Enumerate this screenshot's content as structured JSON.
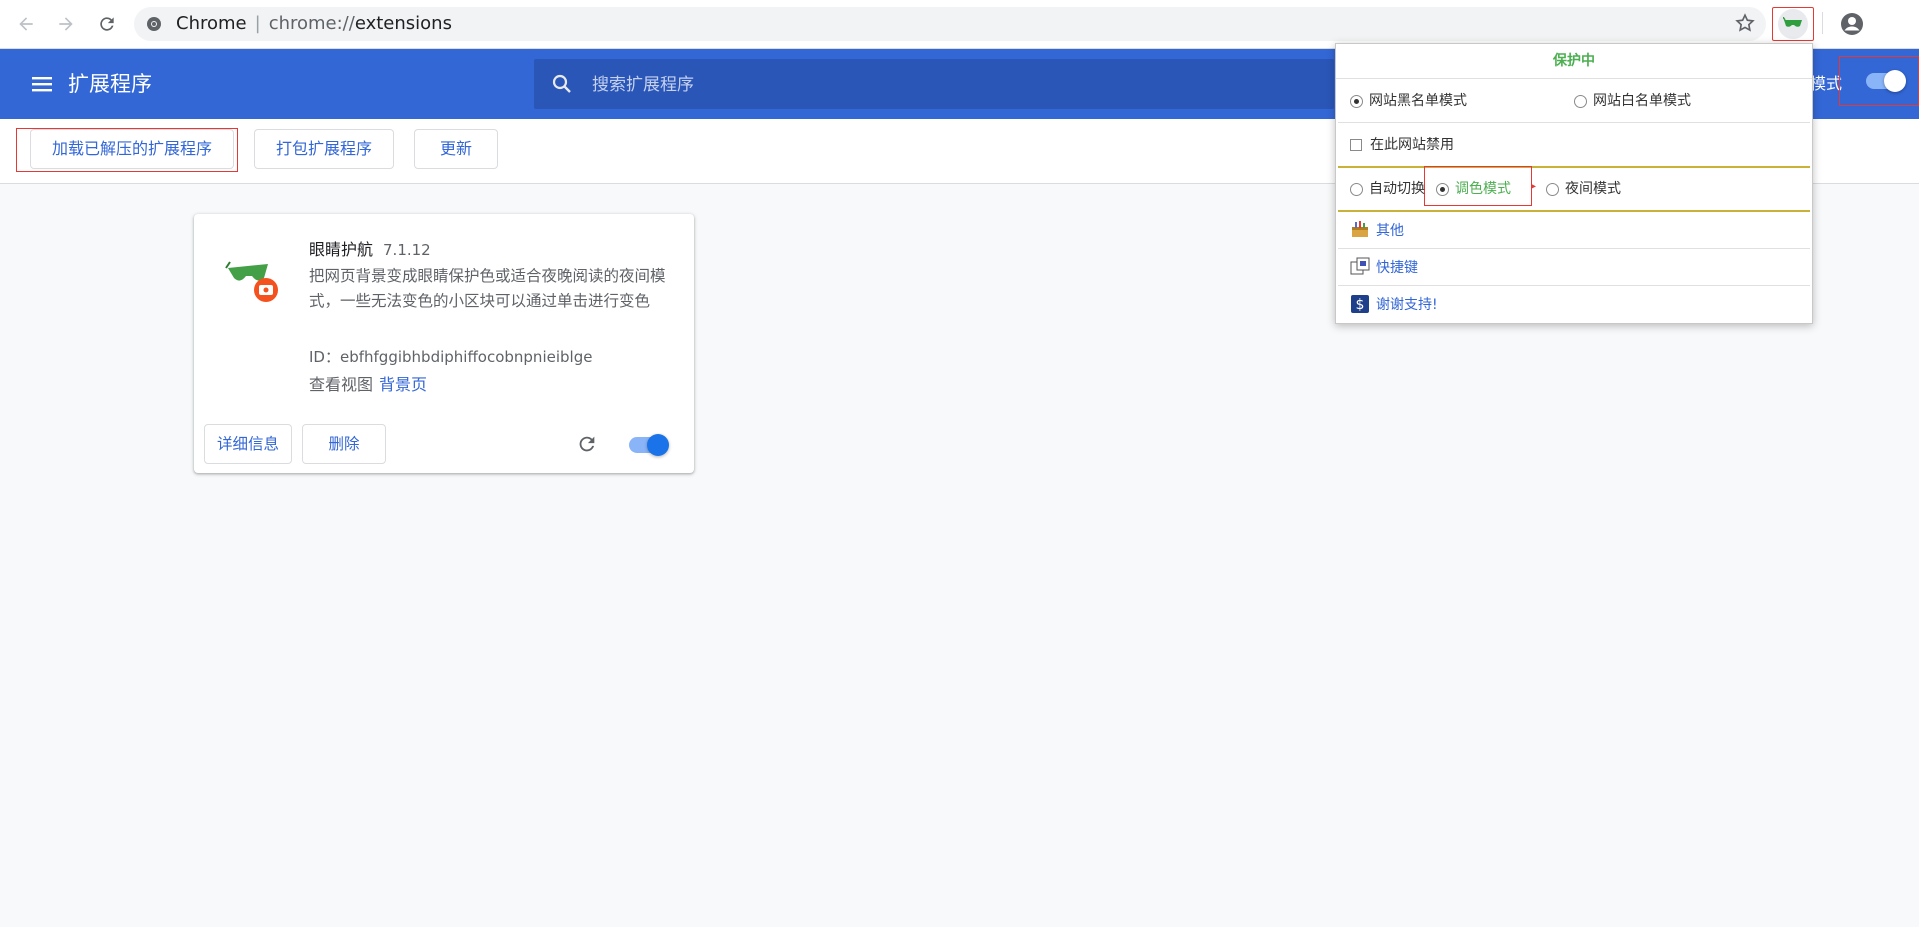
{
  "browser": {
    "site_name": "Chrome",
    "url_scheme": "chrome://",
    "url_path": "extensions"
  },
  "header": {
    "title": "扩展程序",
    "search_placeholder": "搜索扩展程序",
    "dev_mode_label": "模式"
  },
  "actions": {
    "load_unpacked": "加载已解压的扩展程序",
    "pack": "打包扩展程序",
    "update": "更新"
  },
  "extension": {
    "name": "眼睛护航",
    "version": "7.1.12",
    "description": "把网页背景变成眼睛保护色或适合夜晚阅读的夜间模式，一些无法变色的小区块可以通过单击进行变色",
    "id_label": "ID：",
    "id": "ebfhfggibhbdiphiffocobnpnieiblge",
    "views_label": "查看视图",
    "views_link": "背景页",
    "details_button": "详细信息",
    "remove_button": "删除",
    "enabled": true
  },
  "popup": {
    "status": "保护中",
    "blacklist_mode": "网站黑名单模式",
    "whitelist_mode": "网站白名单模式",
    "disable_on_site": "在此网站禁用",
    "auto_switch": "自动切换",
    "color_mode": "调色模式",
    "night_mode": "夜间模式",
    "other": "其他",
    "shortcuts": "快捷键",
    "thanks": "谢谢支持!"
  },
  "colors": {
    "header_blue": "#3367d6",
    "status_green": "#4caf50",
    "highlight_red": "#e53935"
  }
}
